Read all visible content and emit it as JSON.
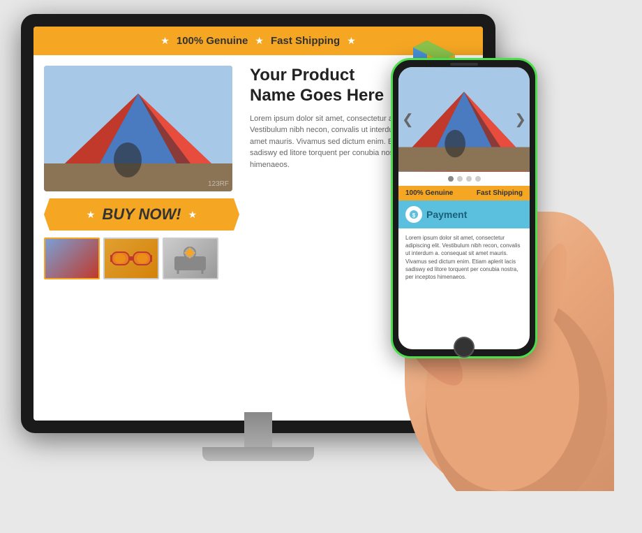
{
  "banner": {
    "badge1": "100% Genuine",
    "badge2": "Fast Shipping",
    "star": "★"
  },
  "product": {
    "name_line1": "Your Product",
    "name_line2": "Name Goes Here",
    "description": "Lorem ipsum dolor sit amet, consectetur adipiscing elit. Vestibulum nibh necon, convalis ut interdum a. Consequat sit amet mauris. Vivamus sed dictum enim. Etiam aplerit lacis sadiswy ed litore torquent per conubia nostra, per inceptos himenaeos.",
    "buy_now": "BUY NOW!",
    "watermark": "123RF"
  },
  "phone": {
    "banner_left": "100% Genuine",
    "banner_right": "Fast Shipping",
    "payment_title": "Payment",
    "payment_desc": "Lorem ipsum dolor sit amet, consectetur adipiscing elit. Vestibulum nibh recon, convalis ut interdum a. consequat sit amet mauris. Vivamus sed dictum enim. Etiam aplerit lacis sadiswy ed litore torquent per conubia nostra, per inceptos himenaeos."
  },
  "icons": {
    "star": "★",
    "arrow_left": "❮",
    "arrow_right": "❯"
  }
}
